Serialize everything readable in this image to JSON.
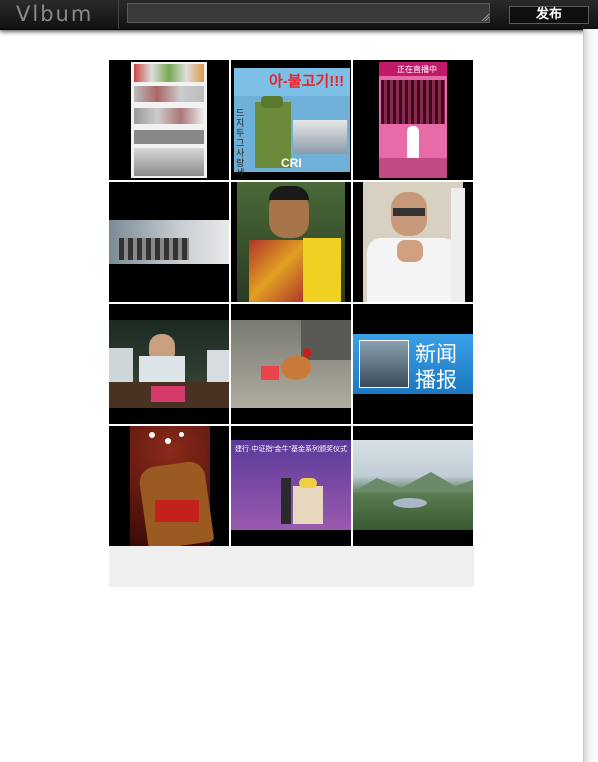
{
  "app": {
    "logo_text": "Vlbum"
  },
  "composer": {
    "value": "",
    "post_button_label": "发布"
  },
  "photos": {
    "poster_banner_text": "아-불고기!!!",
    "poster_logo_text": "CRI",
    "poster_side_text": "드지두 그사랑세 목마여",
    "broadcast_header_text": "正在直播中",
    "news_line1": "新闻",
    "news_line2": "播报",
    "event_banner_text": "建行·中证指“金牛”基金系列颁奖仪式"
  },
  "colors": {
    "topbar": "#1a1a1a",
    "post_button_text": "#ffffff",
    "news_blue": "#2b8fd8",
    "footer_strip": "#efefef"
  }
}
